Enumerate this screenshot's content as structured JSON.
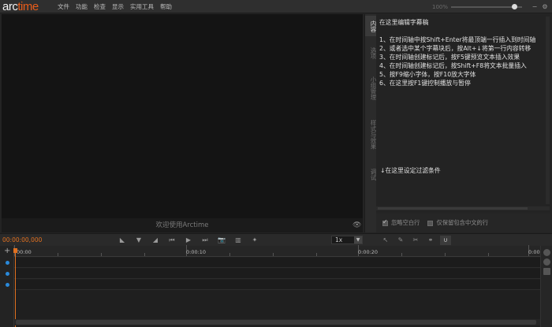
{
  "app": {
    "logo_part1": "arc",
    "logo_part2": "time",
    "accent_color": "#e07020",
    "menu": [
      "文件",
      "功能",
      "检查",
      "显示",
      "实用工具",
      "帮助"
    ],
    "zoom_label": "100%"
  },
  "preview": {
    "welcome_text": "欢迎使用Arctime"
  },
  "side_tabs": [
    "内容",
    "选项",
    "小组管理",
    "样式与效果",
    "调试"
  ],
  "editor": {
    "title_line": "在这里编辑字幕稿",
    "tips": [
      "1、在时间轴中按Shift+Enter将最顶端一行插入到时间轴",
      "2、或者选中某个字幕块后，按Alt+↓将第一行内容转移",
      "3、在时间轴创建标记后，按F5键预览文本插入效果",
      "4、在时间轴创建标记后，按Shift+F8将文本批量插入",
      "5、按F9缩小字体，按F10放大字体",
      "6、在这里按F1键控制播放与暂停"
    ],
    "filter_line": "↓在这里设定过滤条件",
    "options": [
      {
        "label": "忽略空白行",
        "checked": true
      },
      {
        "label": "仅保留包含中文的行",
        "checked": false
      }
    ]
  },
  "controls": {
    "timecode": "00:00:00,000",
    "speed": "1x"
  },
  "timeline": {
    "ruler_labels": [
      "00:00",
      "0:00:10",
      "0:00:20",
      "0:00:3"
    ]
  }
}
